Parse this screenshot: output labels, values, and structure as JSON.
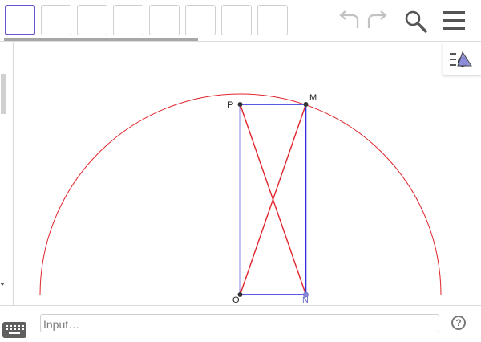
{
  "toolbar": {
    "tools": [
      "move-tool",
      "tool-2",
      "tool-3",
      "tool-4",
      "tool-5",
      "tool-6",
      "tool-7",
      "tool-8"
    ],
    "icons": {
      "undo": "undo-icon",
      "redo": "redo-icon",
      "search": "search-icon",
      "menu": "menu-icon"
    }
  },
  "graphics": {
    "points": [
      {
        "id": "P",
        "label": "P"
      },
      {
        "id": "M",
        "label": "M"
      },
      {
        "id": "O",
        "label": "O"
      },
      {
        "id": "N",
        "label": "N"
      }
    ],
    "colors": {
      "circle": "#e0242b",
      "rectangle": "#2f2fdd",
      "diagonals": "#e0242b",
      "axis": "#222222",
      "point_dark": "#333333",
      "point_n": "#6b6bc9"
    }
  },
  "input_bar": {
    "placeholder": "Input…",
    "help": "?"
  }
}
